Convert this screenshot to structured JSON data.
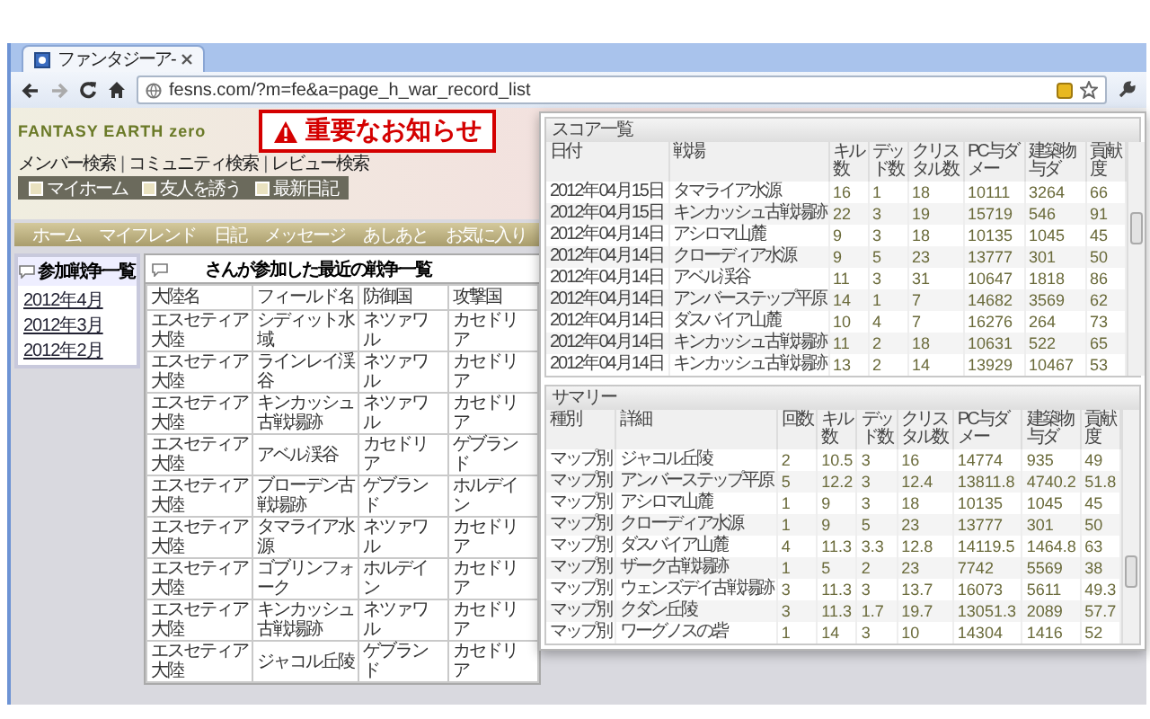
{
  "browser": {
    "tab": {
      "title": "ファンタジーア-"
    },
    "url": "fesns.com/?m=fe&a=page_h_war_record_list"
  },
  "header": {
    "logo": "FANTASY EARTH zero",
    "notice": "重要なお知らせ",
    "separator": "|",
    "search_links": [
      "メンバー検索",
      "コミュニティ検索",
      "レビュー検索"
    ],
    "quick_links": [
      "マイホーム",
      "友人を誘う",
      "最新日記"
    ]
  },
  "nav": [
    "ホーム",
    "マイフレンド",
    "日記",
    "メッセージ",
    "あしあと",
    "お気に入り"
  ],
  "sidebar": {
    "title": "参加戦争一覧",
    "links": [
      "2012年4月",
      "2012年3月",
      "2012年2月"
    ]
  },
  "war_table": {
    "title": "さんが参加した最近の戦争一覧",
    "columns": [
      "大陸名",
      "フィールド名",
      "防御国",
      "攻撃国"
    ],
    "rows": [
      [
        "エスセティア大陸",
        "シディット水域",
        "ネツァワル",
        "カセドリア"
      ],
      [
        "エスセティア大陸",
        "ラインレイ渓谷",
        "ネツァワル",
        "カセドリア"
      ],
      [
        "エスセティア大陸",
        "キンカッシュ古戦場跡",
        "ネツァワル",
        "カセドリア"
      ],
      [
        "エスセティア大陸",
        "アベル渓谷",
        "カセドリア",
        "ゲブランド"
      ],
      [
        "エスセティア大陸",
        "ブローデン古戦場跡",
        "ゲブランド",
        "ホルデイン"
      ],
      [
        "エスセティア大陸",
        "タマライア水源",
        "ネツァワル",
        "カセドリア"
      ],
      [
        "エスセティア大陸",
        "ゴブリンフォーク",
        "ホルデイン",
        "カセドリア"
      ],
      [
        "エスセティア大陸",
        "キンカッシュ古戦場跡",
        "ネツァワル",
        "カセドリア"
      ],
      [
        "エスセティア大陸",
        "ジャコル丘陵",
        "ゲブランド",
        "カセドリア"
      ]
    ]
  },
  "popup": {
    "sections": [
      {
        "title": "スコア一覧",
        "columns": [
          "日付",
          "戦場",
          "キル数",
          "デッド数",
          "クリスタル数",
          "PC与ダメー",
          "建築物与ダ",
          "貢献度"
        ],
        "rows": [
          [
            "2012年04月15日",
            "タマライア水源",
            "16",
            "1",
            "18",
            "10111",
            "3264",
            "66"
          ],
          [
            "2012年04月15日",
            "キンカッシュ古戦場跡",
            "22",
            "3",
            "19",
            "15719",
            "546",
            "91"
          ],
          [
            "2012年04月14日",
            "アシロマ山麓",
            "9",
            "3",
            "18",
            "10135",
            "1045",
            "45"
          ],
          [
            "2012年04月14日",
            "クローディア水源",
            "9",
            "5",
            "23",
            "13777",
            "301",
            "50"
          ],
          [
            "2012年04月14日",
            "アベル渓谷",
            "11",
            "3",
            "31",
            "10647",
            "1818",
            "86"
          ],
          [
            "2012年04月14日",
            "アンバーステップ平原",
            "14",
            "1",
            "7",
            "14682",
            "3569",
            "62"
          ],
          [
            "2012年04月14日",
            "ダスバイア山麓",
            "10",
            "4",
            "7",
            "16276",
            "264",
            "73"
          ],
          [
            "2012年04月14日",
            "キンカッシュ古戦場跡",
            "11",
            "2",
            "18",
            "10631",
            "522",
            "65"
          ],
          [
            "2012年04月14日",
            "キンカッシュ古戦場跡",
            "13",
            "2",
            "14",
            "13929",
            "10467",
            "53"
          ]
        ]
      },
      {
        "title": "サマリー",
        "columns": [
          "種別",
          "詳細",
          "回数",
          "キル数",
          "デッド数",
          "クリスタル数",
          "PC与ダメー",
          "建築物与ダ",
          "貢献度"
        ],
        "rows": [
          [
            "マップ別",
            "ジャコル丘陵",
            "2",
            "10.5",
            "3",
            "16",
            "14774",
            "935",
            "49"
          ],
          [
            "マップ別",
            "アンバーステップ平原",
            "5",
            "12.2",
            "3",
            "12.4",
            "13811.8",
            "4740.2",
            "51.8"
          ],
          [
            "マップ別",
            "アシロマ山麓",
            "1",
            "9",
            "3",
            "18",
            "10135",
            "1045",
            "45"
          ],
          [
            "マップ別",
            "クローディア水源",
            "1",
            "9",
            "5",
            "23",
            "13777",
            "301",
            "50"
          ],
          [
            "マップ別",
            "ダスバイア山麓",
            "4",
            "11.3",
            "3.3",
            "12.8",
            "14119.5",
            "1464.8",
            "63"
          ],
          [
            "マップ別",
            "ザーク古戦場跡",
            "1",
            "5",
            "2",
            "23",
            "7742",
            "5569",
            "38"
          ],
          [
            "マップ別",
            "ウェンズデイ古戦場跡",
            "3",
            "11.3",
            "3",
            "13.7",
            "16073",
            "5611",
            "49.3"
          ],
          [
            "マップ別",
            "クダン丘陵",
            "3",
            "11.3",
            "1.7",
            "19.7",
            "13051.3",
            "2089",
            "57.7"
          ],
          [
            "マップ別",
            "ワーグノスの砦",
            "1",
            "14",
            "3",
            "10",
            "14304",
            "1416",
            "52"
          ]
        ]
      }
    ]
  }
}
